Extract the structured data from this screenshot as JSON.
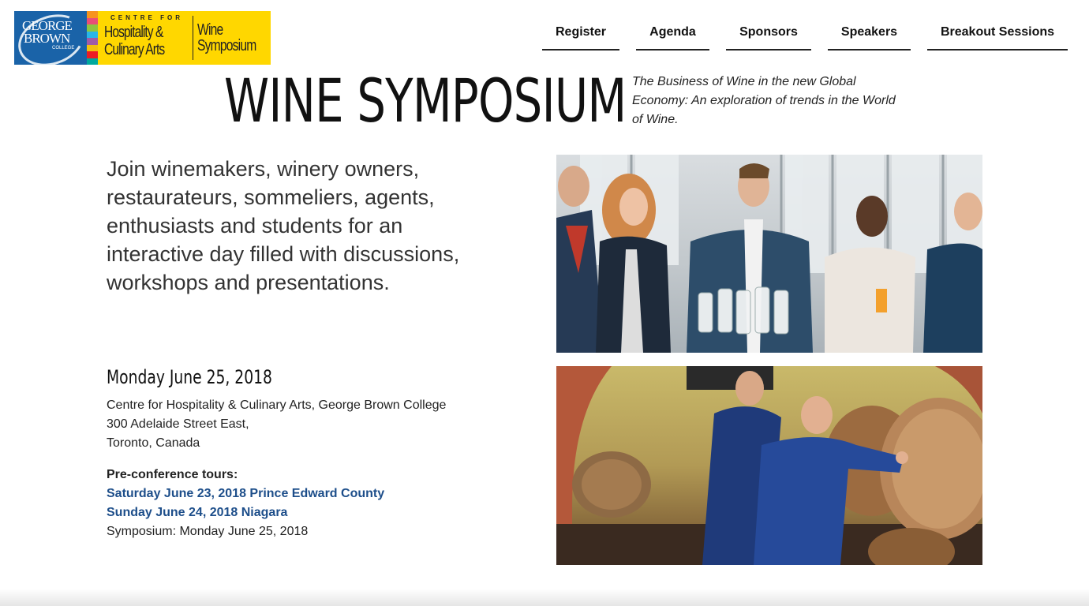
{
  "logo": {
    "line1": "GEORGE",
    "line2": "BROWN",
    "line3": "COLLEGE",
    "centre_for": "CENTRE FOR",
    "hospitality": "Hospitality &",
    "culinary": "Culinary Arts",
    "wine": "Wine",
    "symposium": "Symposium",
    "brand_blue": "#1a63a8",
    "brand_yellow": "#ffd700"
  },
  "nav": {
    "items": [
      {
        "label": "Register"
      },
      {
        "label": "Agenda"
      },
      {
        "label": "Sponsors"
      },
      {
        "label": "Speakers"
      },
      {
        "label": "Breakout Sessions"
      }
    ]
  },
  "header": {
    "title": "WINE SYMPOSIUM",
    "subtitle": "The Business of Wine in the new Global Economy: An exploration of trends in the World of Wine."
  },
  "intro": {
    "text": "Join winemakers, winery owners, restaurateurs, sommeliers, agents, enthusiasts and students for an interactive day filled with discussions, workshops and presentations."
  },
  "event": {
    "date": "Monday June 25, 2018",
    "address_line1": "Centre for Hospitality & Culinary Arts, George Brown College",
    "address_line2": "300 Adelaide Street East,",
    "address_line3": "Toronto, Canada"
  },
  "tours": {
    "heading": "Pre-conference tours:",
    "links": [
      {
        "label": "Saturday June 23, 2018 Prince Edward County"
      },
      {
        "label": "Sunday June 24, 2018 Niagara"
      }
    ],
    "symposium_line": "Symposium: Monday June 25, 2018",
    "link_color": "#1d4e8a"
  },
  "photos": {
    "top": "wine-tasting-group-photo",
    "bottom": "wine-cellar-barrels-photo"
  }
}
